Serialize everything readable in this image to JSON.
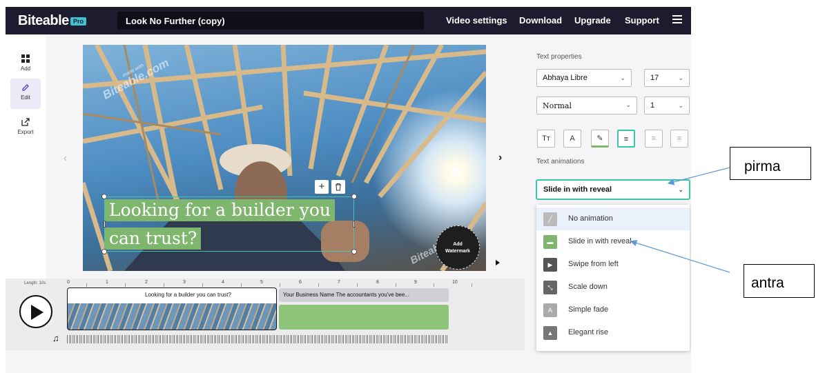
{
  "topbar": {
    "logo": "Biteable",
    "badge": "Pro",
    "project_title": "Look No Further (copy)",
    "nav": [
      "Video settings",
      "Download",
      "Upgrade",
      "Support"
    ]
  },
  "sidebar": {
    "items": [
      {
        "label": "Add",
        "icon": "grid-icon"
      },
      {
        "label": "Edit",
        "icon": "pencil-icon"
      },
      {
        "label": "Export",
        "icon": "export-icon"
      }
    ]
  },
  "canvas": {
    "caption_line1": "Looking for a builder you",
    "caption_line2": "can trust?",
    "watermark_text": "Biteable.com",
    "watermark_small": "made with",
    "add_watermark_line1": "Add",
    "add_watermark_line2": "Watermark",
    "add_icon": "+",
    "trash_icon": "🗑"
  },
  "timeline": {
    "length_label": "Length: 10s",
    "ticks": [
      "0",
      "1",
      "2",
      "3",
      "4",
      "5",
      "6",
      "7",
      "8",
      "9",
      "10"
    ],
    "clip1_label": "Looking for a builder you can trust?",
    "clip2_label": "Your Business Name The accountants you've bee..."
  },
  "panel": {
    "text_properties_heading": "Text properties",
    "font_family": "Abhaya Libre",
    "font_size": "17",
    "font_weight": "Normal",
    "line_height": "1",
    "format_buttons": [
      "Tт",
      "A",
      "✎",
      "≡",
      "≡",
      "≡"
    ],
    "text_animations_heading": "Text animations",
    "selected_animation": "Slide in with reveal",
    "animation_options": [
      "No animation",
      "Slide in with reveal",
      "Swipe from left",
      "Scale down",
      "Simple fade",
      "Elegant rise"
    ]
  },
  "annotations": {
    "label_top": "pirma",
    "label_bottom": "antra"
  },
  "colors": {
    "topbar_bg": "#1c1c2e",
    "accent": "#3cc4a8",
    "caption_green": "#7fb66e"
  }
}
